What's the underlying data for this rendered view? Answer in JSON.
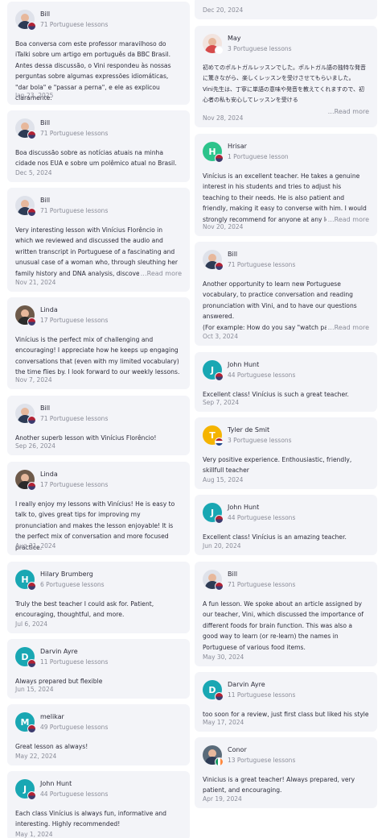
{
  "colors": {
    "card_bg": "#f3f4f8",
    "muted": "#8a8c98",
    "teal": "#19a7b3",
    "green": "#2cc38b",
    "yellow": "#f5b400"
  },
  "read_more_label": "Read more",
  "left": [
    {
      "name": "Bill",
      "lessons": "71 Portuguese lessons",
      "avatar": "photo-bill",
      "text": "Boa conversa com este professor maravilhoso do iTalki sobre um artigo em português da BBC Brasil. Antes dessa discussão, o Vini respondeu às nossas perguntas sobre algumas expressões idiomáticas, \"dar bola\" e \"passar a perna\", e ele as explicou claramente.",
      "date": "Jan 23, 2025"
    },
    {
      "name": "Bill",
      "lessons": "71 Portuguese lessons",
      "avatar": "photo-bill",
      "text": "Boa discussão sobre as notícias atuais na minha cidade nos EUA e sobre um polêmico atual no Brasil.",
      "date": "Dec 5, 2024"
    },
    {
      "name": "Bill",
      "lessons": "71 Portuguese lessons",
      "avatar": "photo-bill",
      "text": "Very interesting lesson with Vinícius Florêncio in which we reviewed and discussed the audio and written transcript in Portuguese of a fascinating and unusual case of a woman who, through sleuthing her family history and DNA analysis, discovered that",
      "date": "Nov 21, 2024",
      "read_more": true
    },
    {
      "name": "Linda",
      "lessons": "17 Portuguese lessons",
      "avatar": "photo-linda",
      "text": "Vinícius is the perfect mix of challenging and encouraging! I appreciate how he keeps up engaging conversations that (even with my limited vocabulary) the time flies by. I look forward to our weekly lessons.",
      "date": "Nov 7, 2024"
    },
    {
      "name": "Bill",
      "lessons": "71 Portuguese lessons",
      "avatar": "photo-bill",
      "text": "Another superb lesson with Vinícius Florêncio!",
      "date": "Sep 26, 2024"
    },
    {
      "name": "Linda",
      "lessons": "17 Portuguese lessons",
      "avatar": "photo-linda",
      "text": "I really enjoy my lessons with Vinícius! He is easy to talk to, gives great tips for improving my pronunciation and makes the lesson enjoyable! It is the perfect mix of conversation and more focused practice.",
      "date": "Aug 31, 2024"
    },
    {
      "name": "Hilary Brumberg",
      "lessons": "6 Portuguese lessons",
      "avatar": "H",
      "avatar_color": "#19a7b3",
      "text": "Truly the best teacher I could ask for. Patient, encouraging, thoughtful, and more.",
      "date": "Jul 6, 2024"
    },
    {
      "name": "Darvin Ayre",
      "lessons": "11 Portuguese lessons",
      "avatar": "D",
      "avatar_color": "#19a7b3",
      "text": "Always prepared but flexible",
      "date": "Jun 15, 2024"
    },
    {
      "name": "melikar",
      "lessons": "49 Portuguese lessons",
      "avatar": "M",
      "avatar_color": "#19a7b3",
      "text": "Great lesson as always!",
      "date": "May 22, 2024"
    },
    {
      "name": "John Hunt",
      "lessons": "44 Portuguese lessons",
      "avatar": "J",
      "avatar_color": "#19a7b3",
      "text": "Each class Vinícius is always fun, informative and interesting. Highly recommended!",
      "date": "May 1, 2024"
    }
  ],
  "right": [
    {
      "date": "Dec 20, 2024"
    },
    {
      "name": "May",
      "lessons": "3 Portuguese lessons",
      "avatar": "photo-may",
      "text": "初めてのポルトガルレッスンでした。ポルトガル語の独特な発音に驚きながら、楽しくレッスンを受けさせてもらいました。\nVini先生は、丁寧に単語の意味や発音を教えてくれますので、初心者の私も安心してレッスンを受ける",
      "date": "Nov 28, 2024",
      "read_more": true,
      "jp": true
    },
    {
      "name": "Hrisar",
      "lessons": "1 Portuguese lesson",
      "avatar": "H",
      "avatar_color": "#2cc38b",
      "text": "Vinícius is an excellent teacher. He takes a genuine interest in his students and tries to adjust his teaching to their needs. He is also patient and friendly, making it easy to converse with him.  I would strongly recommend for anyone at any level of Po",
      "date": "Nov 20, 2024",
      "read_more": true
    },
    {
      "name": "Bill",
      "lessons": "71 Portuguese lessons",
      "avatar": "photo-bill",
      "text": "Another opportunity to learn new Portuguese vocabulary, to practice conversation and reading pronunciation with Vini, and to have our questions answered.\n(For example: How do you say \"watch par",
      "date": "Oct 3, 2024",
      "read_more": true
    },
    {
      "name": "John Hunt",
      "lessons": "44 Portuguese lessons",
      "avatar": "J",
      "avatar_color": "#19a7b3",
      "text": "Excellent class! Vinícius is such a great teacher.",
      "date": "Sep 7, 2024"
    },
    {
      "name": "Tyler de Smit",
      "lessons": "3 Portuguese lessons",
      "avatar": "T",
      "avatar_color": "#f5b400",
      "text": "Very positive experience. Enthousiastic, friendly, skillfull teacher",
      "date": "Aug 15, 2024"
    },
    {
      "name": "John Hunt",
      "lessons": "44 Portuguese lessons",
      "avatar": "J",
      "avatar_color": "#19a7b3",
      "text": "Excellent class! Vinícius is an amazing teacher.",
      "date": "Jun 20, 2024"
    },
    {
      "name": "Bill",
      "lessons": "71 Portuguese lessons",
      "avatar": "photo-bill",
      "text": "A fun lesson. We spoke about an article assigned by our teacher, Vini, which discussed the importance of different foods for brain function. This was also a good way to learn (or re-learn) the names in Portuguese of various food items.",
      "date": "May 30, 2024"
    },
    {
      "name": "Darvin Ayre",
      "lessons": "11 Portuguese lessons",
      "avatar": "D",
      "avatar_color": "#19a7b3",
      "text": "too soon for a review, just first class but liked his style",
      "date": "May 17, 2024"
    },
    {
      "name": "Conor",
      "lessons": "13 Portuguese lessons",
      "avatar": "photo-conor",
      "text": "Vinicius is a great teacher! Always prepared, very patient, and encouraging.",
      "date": "Apr 19, 2024"
    }
  ]
}
